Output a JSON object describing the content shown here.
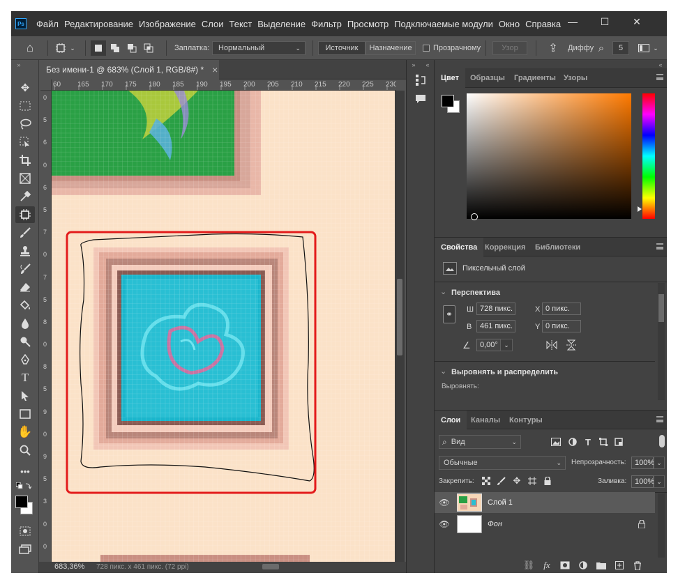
{
  "app": {
    "logo": "Ps",
    "icon": "photoshop-logo"
  },
  "menu": [
    "Файл",
    "Редактирование",
    "Изображение",
    "Слои",
    "Текст",
    "Выделение",
    "Фильтр",
    "Просмотр",
    "Подключаемые модули",
    "Окно",
    "Справка"
  ],
  "window_controls": {
    "minimize": "—",
    "maximize": "☐",
    "close": "✕"
  },
  "options": {
    "patch_label": "Заплатка:",
    "patch_mode": "Нормальный",
    "source": "Источник",
    "destination": "Назначение",
    "transparent": "Прозрачному",
    "pattern": "Узор",
    "diffusion": "Диффу",
    "size_value": "5"
  },
  "document": {
    "tab_title": "Без имени-1 @ 683% (Слой 1, RGB/8#) *",
    "close": "×",
    "ruler_h": [
      "60",
      "165",
      "170",
      "175",
      "180",
      "185",
      "190",
      "195",
      "200",
      "205",
      "210",
      "215",
      "220",
      "225",
      "230"
    ],
    "ruler_v": [
      "0",
      "5",
      "6",
      "0",
      "6",
      "5",
      "7",
      "0",
      "7",
      "5",
      "8",
      "0",
      "8",
      "5",
      "9",
      "0",
      "9",
      "5",
      "3",
      "0",
      "0"
    ],
    "status_zoom": "683,36%",
    "status_info": "728 пикс. x 461 пикс. (72 ppi)"
  },
  "color_panel": {
    "tabs": [
      "Цвет",
      "Образцы",
      "Градиенты",
      "Узоры"
    ]
  },
  "properties_panel": {
    "tabs": [
      "Свойства",
      "Коррекция",
      "Библиотеки"
    ],
    "layer_type": "Пиксельный слой",
    "section_transform": "Перспектива",
    "w_label": "Ш",
    "w_value": "728 пикс.",
    "h_label": "В",
    "h_value": "461 пикс.",
    "x_label": "X",
    "x_value": "0 пикс.",
    "y_label": "Y",
    "y_value": "0 пикс.",
    "angle_value": "0,00°",
    "section_align": "Выровнять и распределить",
    "align_label": "Выровнять:"
  },
  "layers_panel": {
    "tabs": [
      "Слои",
      "Каналы",
      "Контуры"
    ],
    "filter_kind": "Вид",
    "blend_mode": "Обычные",
    "opacity_label": "Непрозрачность:",
    "opacity_value": "100%",
    "lock_label": "Закрепить:",
    "fill_label": "Заливка:",
    "fill_value": "100%",
    "layers": [
      {
        "name": "Слой 1",
        "selected": true,
        "visible": true
      },
      {
        "name": "Фон",
        "selected": false,
        "visible": true,
        "locked": true
      }
    ]
  },
  "colors": {
    "highlight_red": "#e31b1b",
    "cyan_fill": "#20b8cf",
    "canvas_bg": "#fbe2c8"
  }
}
